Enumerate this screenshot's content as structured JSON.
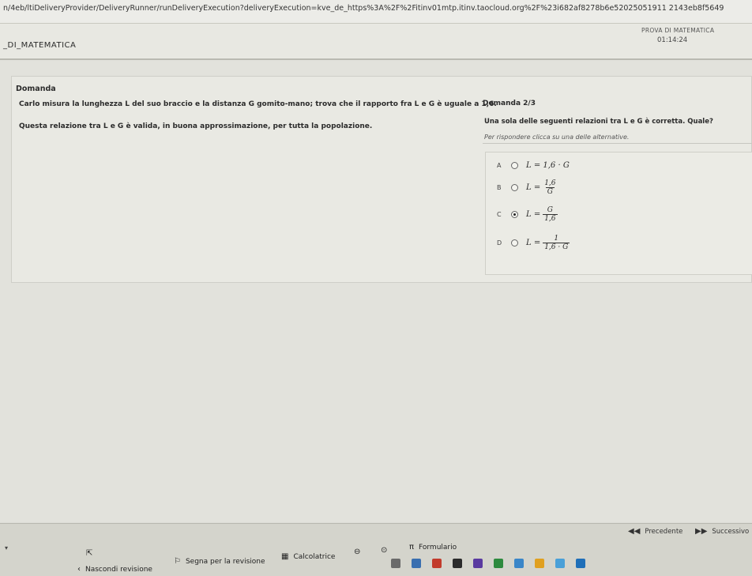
{
  "browser": {
    "url": "n/4eb/ltiDeliveryProvider/DeliveryRunner/runDeliveryExecution?deliveryExecution=kve_de_https%3A%2F%2Fitinv01mtp.itinv.taocloud.org%2F%23i682af8278b6e52025051911 2143eb8f5649"
  },
  "header": {
    "test_name": "_DI_MATEMATICA",
    "prova_label": "PROVA DI MATEMATICA",
    "timer": "01:14:24"
  },
  "question": {
    "section_label": "Domanda",
    "stem_line1": "Carlo misura la lunghezza L del suo braccio e la distanza G gomito-mano; trova che il rapporto fra L e G è uguale a 1,6.",
    "stem_line2": "Questa relazione tra L e G è valida, in buona approssimazione, per tutta la popolazione.",
    "number": "Domanda 2/3",
    "prompt": "Una sola delle seguenti relazioni tra L e G è corretta. Quale?",
    "hint": "Per rispondere clicca su una delle alternative."
  },
  "options": [
    {
      "letter": "A",
      "selected": false,
      "lhs": "L = 1,6 · G"
    },
    {
      "letter": "B",
      "selected": false,
      "lhs": "L =",
      "num": "1,6",
      "den": "G"
    },
    {
      "letter": "C",
      "selected": true,
      "lhs": "L =",
      "num": "G",
      "den": "1,6"
    },
    {
      "letter": "D",
      "selected": false,
      "lhs": "L =",
      "num": "1",
      "den": "1,6 · G"
    }
  ],
  "footer": {
    "prev_label": "Precedente",
    "next_label": "Successivo",
    "hide_review": "Nascondi revisione",
    "mark_review": "Segna per la revisione",
    "calculator": "Calcolatrice",
    "formulary": "Formulario",
    "pi_symbol": "π"
  },
  "icons": [
    "flag-icon",
    "calculator-icon",
    "zoom-out-icon",
    "zoom-in-icon",
    "prev-arrow-icon",
    "next-arrow-icon",
    "pointer-cursor-icon"
  ]
}
